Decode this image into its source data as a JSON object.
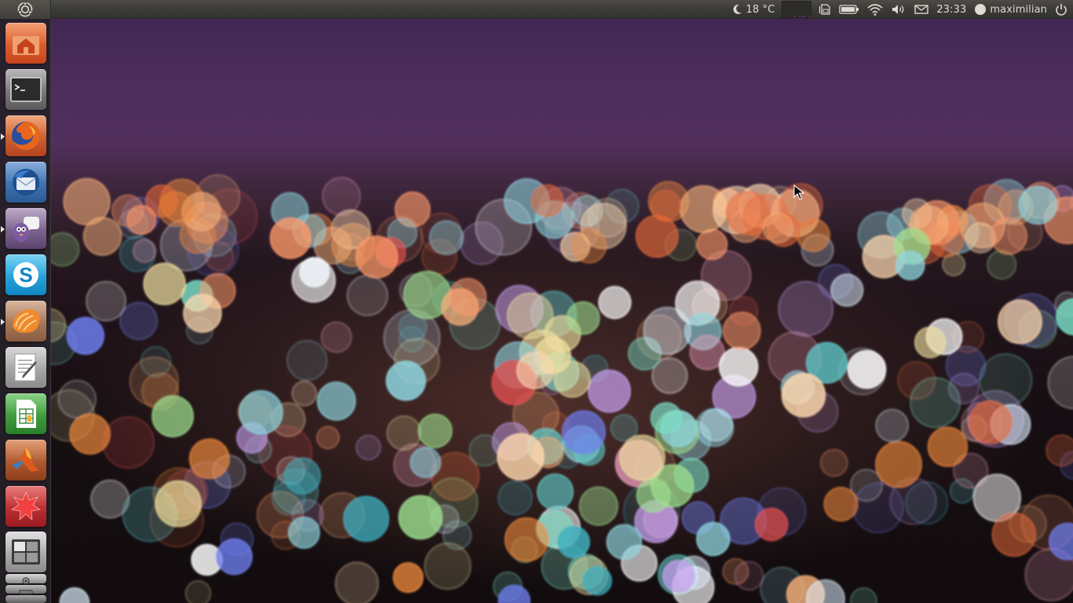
{
  "desktop": {
    "colors": {
      "panel": "#3b3a36",
      "launcher": "#262028",
      "sky": "#4a2c5b"
    }
  },
  "top_panel": {
    "logo_icon": "ubuntu-logo-icon",
    "weather": {
      "icon": "moon-icon",
      "temperature": "18 °C"
    },
    "system_monitor_icon": "system-monitor-graph",
    "indicators": [
      "sim-card-icon",
      "battery-icon",
      "wifi-icon",
      "volume-icon",
      "mail-icon"
    ],
    "clock": "23:33",
    "user": {
      "icon": "user-status-icon",
      "name": "maximilian"
    },
    "session_icon": "power-icon"
  },
  "launcher": {
    "items": [
      {
        "name": "home-folder",
        "icon": "home-folder-icon",
        "color": "#dd5b2b",
        "running": false
      },
      {
        "name": "terminal",
        "icon": "terminal-icon",
        "color": "#6c6c6c",
        "running": false
      },
      {
        "name": "firefox",
        "icon": "firefox-icon",
        "color": "#c5532a",
        "running": true
      },
      {
        "name": "thunderbird",
        "icon": "thunderbird-icon",
        "color": "#3f6fa8",
        "running": false
      },
      {
        "name": "pidgin",
        "icon": "pidgin-icon",
        "color": "#7a5a8a",
        "running": true
      },
      {
        "name": "skype",
        "icon": "skype-icon",
        "color": "#1a9ed9",
        "running": false
      },
      {
        "name": "clementine",
        "icon": "clementine-icon",
        "color": "#c86a2c",
        "running": true
      },
      {
        "name": "text-editor",
        "icon": "text-editor-icon",
        "color": "#8f8f8f",
        "running": false
      },
      {
        "name": "spreadsheet",
        "icon": "spreadsheet-icon",
        "color": "#3d9a3a",
        "running": false
      },
      {
        "name": "matlab",
        "icon": "matlab-icon",
        "color": "#b85a2a",
        "running": false
      },
      {
        "name": "mathematica",
        "icon": "mathematica-icon",
        "color": "#c0272d",
        "running": false
      },
      {
        "name": "workspaces",
        "icon": "workspace-switcher-icon",
        "color": "#9a9a9a",
        "running": false
      }
    ]
  }
}
